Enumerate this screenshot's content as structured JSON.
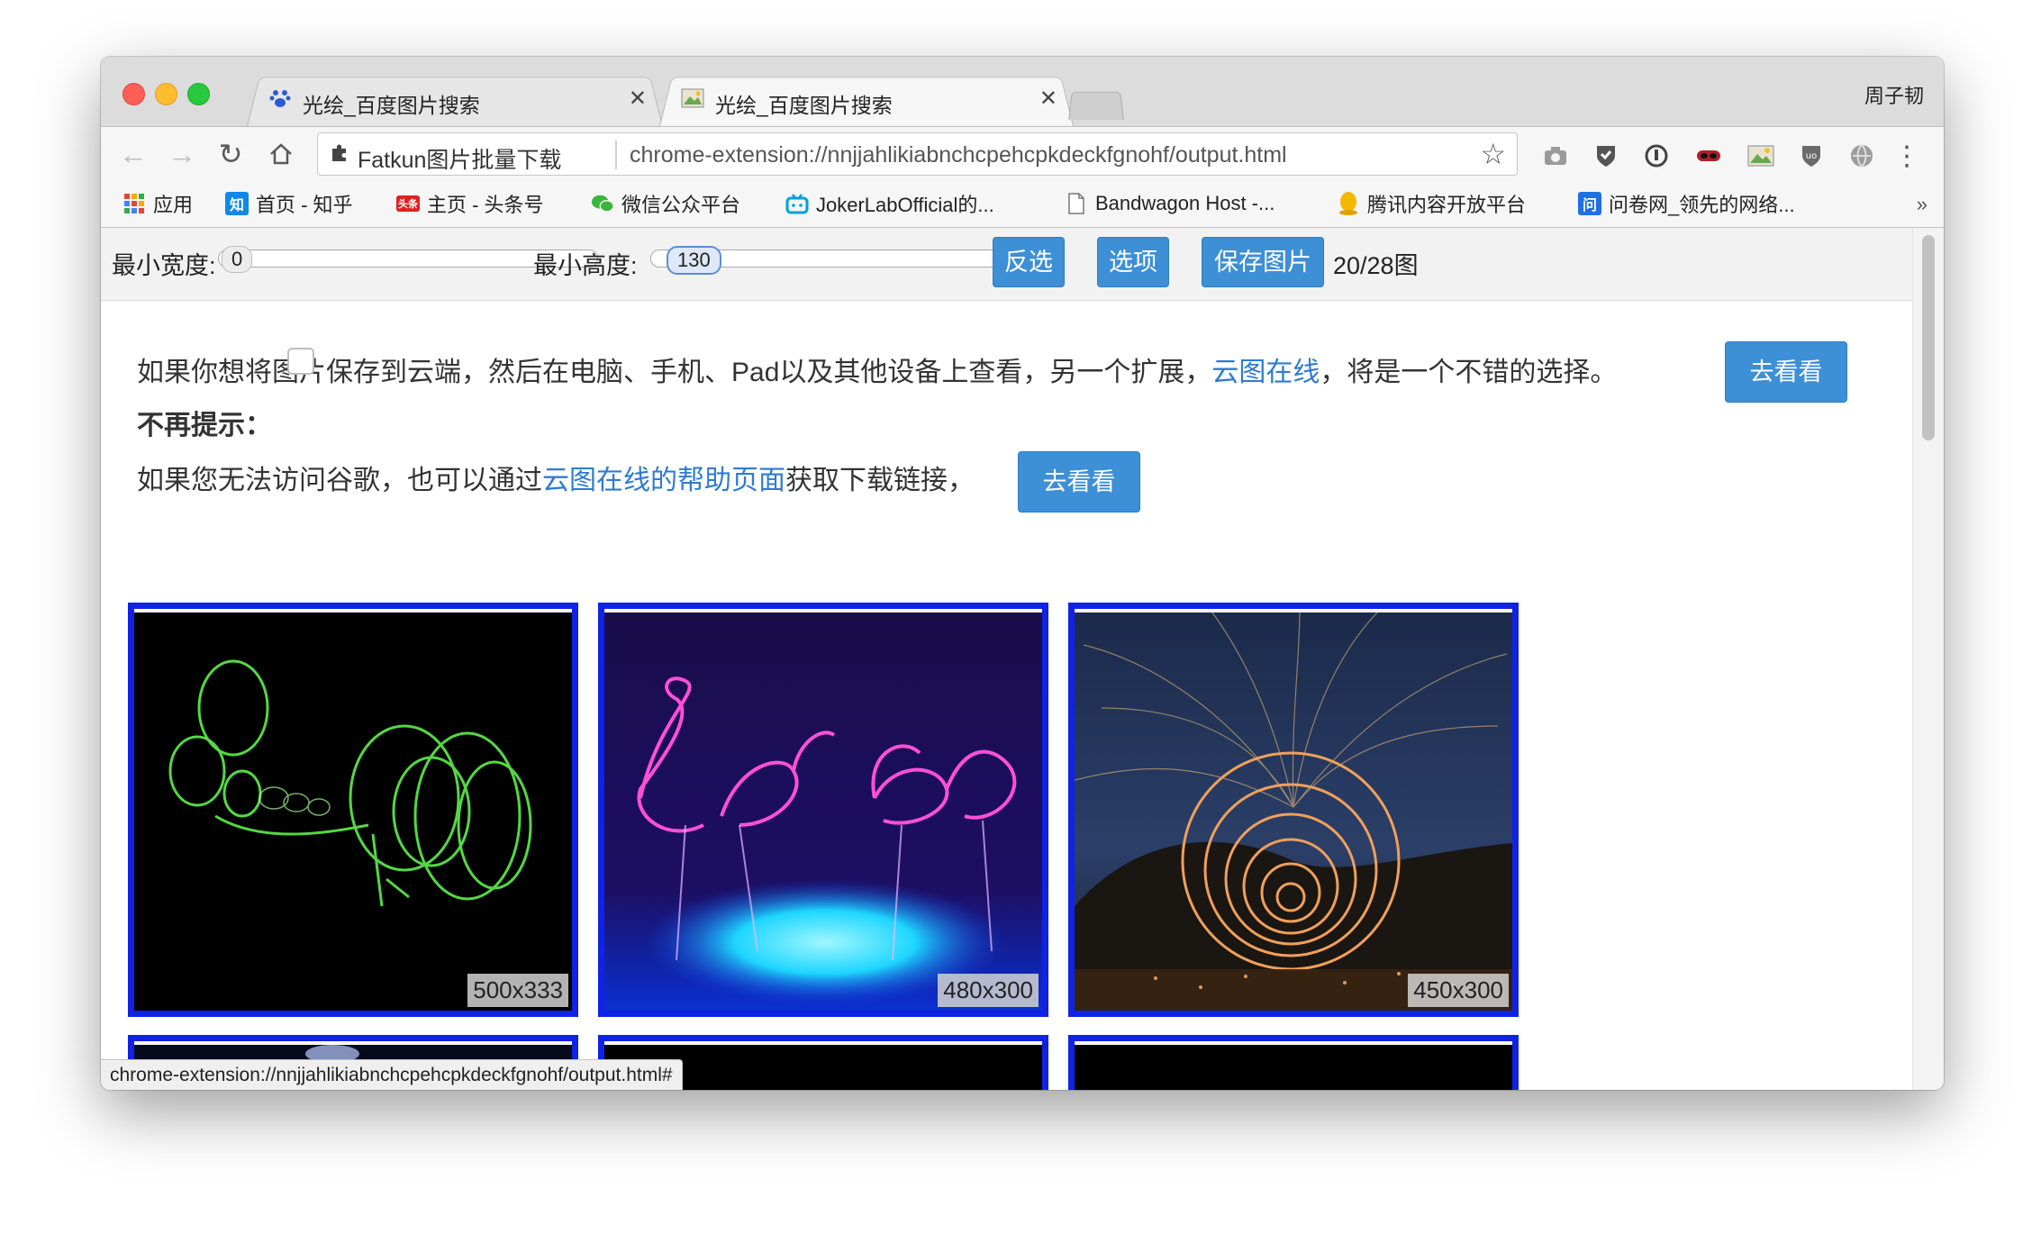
{
  "window": {
    "tabs": [
      {
        "title": "光绘_百度图片搜索",
        "active": false,
        "icon": "baidu-paw-icon"
      },
      {
        "title": "光绘_百度图片搜索",
        "active": true,
        "icon": "image-icon"
      }
    ],
    "profile_name": "周子韧"
  },
  "toolbar": {
    "extension_name": "Fatkun图片批量下载",
    "url": "chrome-extension://nnjjahlikiabnchcpehcpkdeckfgnohf/output.html"
  },
  "bookmarks": [
    {
      "label": "应用",
      "icon": "apps-grid-icon"
    },
    {
      "label": "首页 - 知乎",
      "icon": "zhihu-icon"
    },
    {
      "label": "主页 - 头条号",
      "icon": "toutiao-icon"
    },
    {
      "label": "微信公众平台",
      "icon": "wechat-icon"
    },
    {
      "label": "JokerLabOfficial的...",
      "icon": "bilibili-icon"
    },
    {
      "label": "Bandwagon Host -...",
      "icon": "page-icon"
    },
    {
      "label": "腾讯内容开放平台",
      "icon": "qq-penguin-icon"
    },
    {
      "label": "问卷网_领先的网络...",
      "icon": "wenjuan-icon"
    }
  ],
  "controls": {
    "min_width_label": "最小宽度:",
    "min_width_value": "0",
    "min_height_label": "最小高度:",
    "min_height_value": "130",
    "invert_label": "反选",
    "options_label": "选项",
    "save_label": "保存图片",
    "count": "20/28图"
  },
  "messages": {
    "line1_prefix": "如果你想将图片保存到云端，然后在电脑、手机、Pad以及其他设备上查看，另一个扩展，",
    "line1_link": "云图在线",
    "line1_suffix": "，将是一个不错的选择。",
    "go_button": "去看看",
    "no_more_label": "不再提示：",
    "line2_prefix": "如果您无法访问谷歌，也可以通过",
    "line2_link": "云图在线的帮助页面",
    "line2_suffix": "获取下载链接，",
    "go_button2": "去看看"
  },
  "images": [
    {
      "dimensions": "500x333"
    },
    {
      "dimensions": "480x300"
    },
    {
      "dimensions": "450x300"
    }
  ],
  "status_bar": "chrome-extension://nnjjahlikiabnchcpehcpkdeckfgnohf/output.html#"
}
